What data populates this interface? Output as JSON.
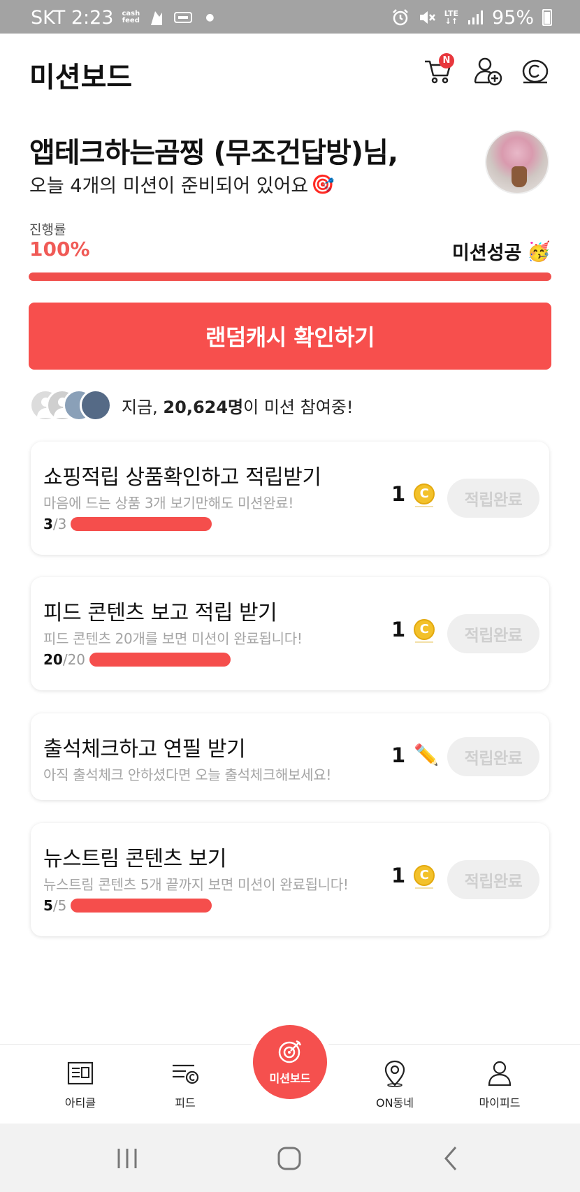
{
  "status_bar": {
    "carrier_time": "SKT 2:23",
    "cashfeed_line1": "cash",
    "cashfeed_line2": "feed",
    "network_line1": "LTE",
    "network_line2": "↓↑",
    "battery": "95%",
    "icons": [
      "cashfeed-icon",
      "app-icon",
      "app-icon",
      "alarm-icon",
      "mute-icon",
      "signal-icon",
      "battery-icon"
    ]
  },
  "header": {
    "title": "미션보드",
    "cart_badge": "N",
    "icons": [
      "cart-icon",
      "add-friend-icon",
      "coin-icon"
    ]
  },
  "greeting": {
    "name_line": "앱테크하는곰찡 (무조건답방)님,",
    "sub_line": "오늘 4개의 미션이 준비되어 있어요",
    "sub_emoji": "🎯"
  },
  "progress": {
    "label": "진행률",
    "percent_text": "100%",
    "percent_value": 1.0,
    "status_text": "미션성공",
    "status_emoji": "🥳"
  },
  "random_cash_button": "랜덤캐시 확인하기",
  "participants": {
    "prefix": "지금, ",
    "count": "20,624명",
    "suffix": "이 미션 참여중!"
  },
  "missions": [
    {
      "title": "쇼핑적립 상품확인하고 적립받기",
      "desc": "마음에 드는 상품 3개 보기만해도 미션완료!",
      "done": "3",
      "total": "/3",
      "fraction": 1.0,
      "reward_amount": "1",
      "reward_icon": "coin-icon",
      "reward_coin_symbol": "C",
      "button": "적립완료"
    },
    {
      "title": "피드 콘텐츠 보고 적립 받기",
      "desc": "피드 콘텐츠 20개를 보면 미션이 완료됩니다!",
      "done": "20",
      "total": "/20",
      "fraction": 1.0,
      "reward_amount": "1",
      "reward_icon": "coin-icon",
      "reward_coin_symbol": "C",
      "button": "적립완료"
    },
    {
      "title": "출석체크하고 연필 받기",
      "desc": "아직 출석체크 안하셨다면 오늘 출석체크해보세요!",
      "reward_amount": "1",
      "reward_icon": "pencil-icon",
      "reward_pencil": "✏️",
      "button": "적립완료"
    },
    {
      "title": "뉴스트림 콘텐츠 보기",
      "desc": "뉴스트림 콘텐츠 5개 끝까지 보면 미션이 완료됩니다!",
      "done": "5",
      "total": "/5",
      "fraction": 1.0,
      "reward_amount": "1",
      "reward_icon": "coin-icon",
      "reward_coin_symbol": "C",
      "button": "적립완료"
    }
  ],
  "bottom_nav": {
    "items": [
      {
        "label": "아티클",
        "icon": "article-icon"
      },
      {
        "label": "피드",
        "icon": "feed-icon"
      },
      {
        "label": "미션보드",
        "icon": "target-icon",
        "active": true
      },
      {
        "label": "ON동네",
        "icon": "location-pin-icon"
      },
      {
        "label": "마이피드",
        "icon": "person-icon"
      }
    ]
  },
  "system_nav": {
    "icons": [
      "recent-apps-icon",
      "home-icon",
      "back-icon"
    ]
  },
  "colors": {
    "accent": "#f5504e",
    "progress_track": "#f2d6d5",
    "done_button_bg": "#efefef",
    "done_button_text": "#cfcfcf",
    "status_bar": "#a3a3a3",
    "coin": "#f3c12a"
  }
}
